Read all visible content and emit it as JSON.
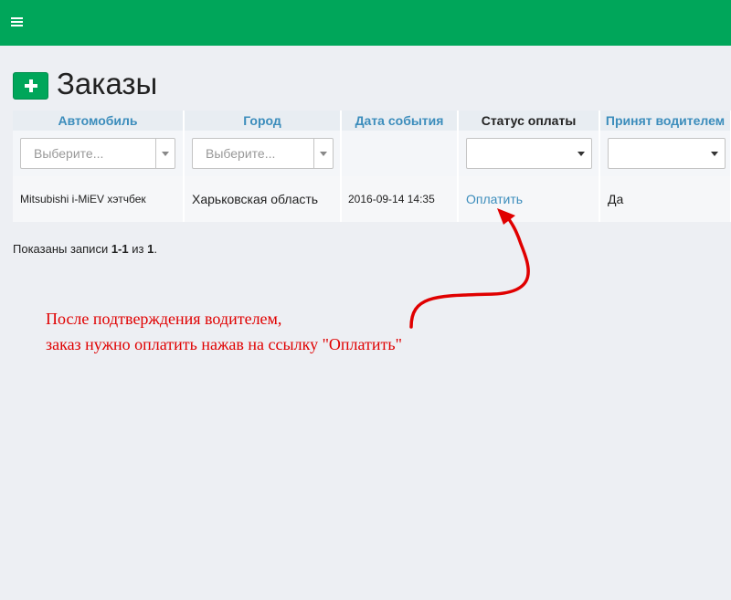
{
  "topbar": {
    "menu_icon": "hamburger-menu-icon",
    "color": "#00a65a"
  },
  "page": {
    "title": "Заказы",
    "add_icon": "plus-icon"
  },
  "table": {
    "columns": [
      {
        "label": "Автомобиль",
        "sortable": true
      },
      {
        "label": "Город",
        "sortable": true
      },
      {
        "label": "Дата события",
        "sortable": true
      },
      {
        "label": "Статус оплаты",
        "sortable": false
      },
      {
        "label": "Принят водителем",
        "sortable": true
      }
    ],
    "filters": {
      "car_placeholder": "Выберите...",
      "city_placeholder": "Выберите...",
      "payment_status": "",
      "accepted": ""
    },
    "rows": [
      {
        "car": "Mitsubishi i-MiEV хэтчбек",
        "city": "Харьковская область",
        "date": "2016-09-14 14:35",
        "payment": "Оплатить",
        "accepted": "Да"
      }
    ]
  },
  "summary": {
    "prefix": "Показаны записи ",
    "range": "1-1",
    "middle": " из ",
    "total": "1",
    "suffix": "."
  },
  "annotation": {
    "line1": "После подтверждения водителем,",
    "line2": "заказ нужно оплатить нажав на ссылку \"Оплатить\"",
    "color": "#e00000"
  }
}
